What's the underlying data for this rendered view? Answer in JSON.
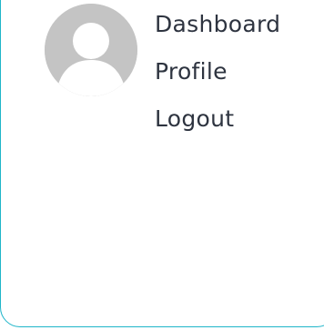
{
  "avatar": {
    "icon": "user-avatar-icon",
    "background_color": "#c4c4c4",
    "figure_color": "#ffffff"
  },
  "menu": {
    "items": [
      {
        "label": "Dashboard"
      },
      {
        "label": "Profile"
      },
      {
        "label": "Logout"
      }
    ]
  },
  "colors": {
    "panel_border": "#1fb5c9",
    "text": "#2e3440"
  }
}
